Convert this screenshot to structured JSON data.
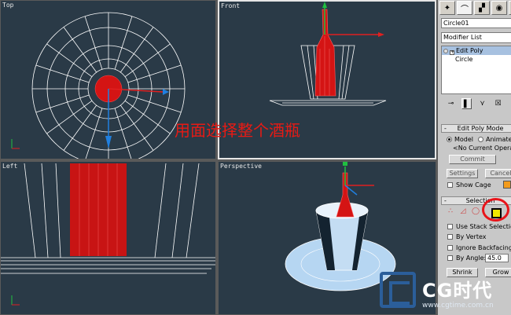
{
  "viewports": {
    "top": {
      "label": "Top"
    },
    "front": {
      "label": "Front"
    },
    "left": {
      "label": "Left"
    },
    "perspective": {
      "label": "Perspective"
    }
  },
  "annotation": "用面选择整个酒瓶",
  "colors": {
    "viewport_bg": "#2a3a47",
    "wire": "#ffffff",
    "selected_faces": "#d41414",
    "annotation": "#e81a14",
    "highlight_circle": "#e8141a",
    "poly_icon": "#f0e800",
    "axis_x": "#e02020",
    "axis_y": "#2080e0",
    "axis_z": "#20c040"
  },
  "command_panel": {
    "tabs": [
      {
        "icon": "create-icon",
        "glyph": "✦"
      },
      {
        "icon": "modify-icon",
        "glyph": "⌒"
      },
      {
        "icon": "hierarchy-icon",
        "glyph": "▞"
      },
      {
        "icon": "motion-icon",
        "glyph": "◉"
      },
      {
        "icon": "display-icon",
        "glyph": "▣"
      }
    ],
    "object_name": "Circle01",
    "modifier_list": "Modifier List",
    "stack": [
      {
        "label": "Edit Poly",
        "selected": true
      },
      {
        "label": "Circle",
        "selected": false
      }
    ],
    "stack_tools": [
      {
        "icon": "pin-stack-icon",
        "glyph": "⊸"
      },
      {
        "icon": "show-end-result-icon",
        "glyph": "▌"
      },
      {
        "icon": "make-unique-icon",
        "glyph": "⋎"
      },
      {
        "icon": "remove-modifier-icon",
        "glyph": "☒"
      },
      {
        "icon": "configure-sets-icon",
        "glyph": "▤"
      }
    ],
    "edit_poly_mode": {
      "title": "Edit Poly Mode",
      "sign": "-",
      "model_label": "Model",
      "animate_label": "Animate",
      "current_op": "<No Current Operation>",
      "commit_label": "Commit",
      "settings_label": "Settings",
      "cancel_label": "Cancel",
      "show_cage_label": "Show Cage"
    },
    "selection": {
      "title": "Selection",
      "sign": "-",
      "icons": [
        {
          "icon": "vertex-icon",
          "glyph": "∴"
        },
        {
          "icon": "edge-icon",
          "glyph": "◿"
        },
        {
          "icon": "border-icon",
          "glyph": "◯"
        },
        {
          "icon": "polygon-icon",
          "glyph": "■"
        }
      ],
      "use_stack_label": "Use Stack Selection",
      "by_vertex_label": "By Vertex",
      "ignore_backfacing_label": "Ignore Backfacing",
      "by_angle_label": "By Angle:",
      "by_angle_value": "45.0",
      "shrink_label": "Shrink",
      "grow_label": "Grow"
    }
  },
  "watermark": {
    "brand": "CG时代",
    "url": "www.cgtime.com.cn"
  }
}
